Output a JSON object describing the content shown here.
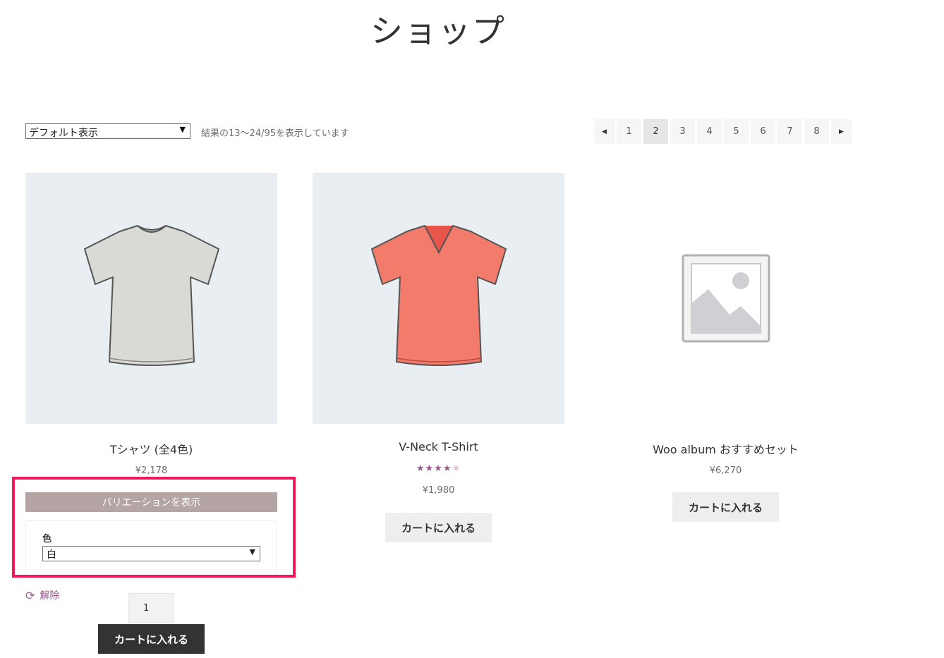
{
  "page": {
    "title": "ショップ"
  },
  "toolbar": {
    "sort_value": "デフォルト表示",
    "result_count": "結果の13〜24/95を表示しています"
  },
  "pagination": {
    "prev": "◀",
    "next": "▶",
    "pages": [
      "1",
      "2",
      "3",
      "4",
      "5",
      "6",
      "7",
      "8"
    ],
    "current": "2"
  },
  "products": [
    {
      "title": "Tシャツ (全4色)",
      "price": "¥2,178",
      "color": "#d9d9d6"
    },
    {
      "title": "V-Neck T-Shirt",
      "price": "¥1,980",
      "rating": 4,
      "rating_max": 5,
      "button": "カートに入れる",
      "color": "#f37b6b"
    },
    {
      "title": "Woo album おすすめセット",
      "price": "¥6,270",
      "button": "カートに入れる"
    }
  ],
  "variation": {
    "toggle_label": "バリエーションを表示",
    "attribute_label": "色",
    "selected": "白",
    "reset_label": "解除",
    "quantity": "1",
    "add_to_cart": "カートに入れる"
  },
  "colors": {
    "accent": "#96588a",
    "highlight": "#f2195a",
    "variation_bar": "#b5a4a4"
  }
}
